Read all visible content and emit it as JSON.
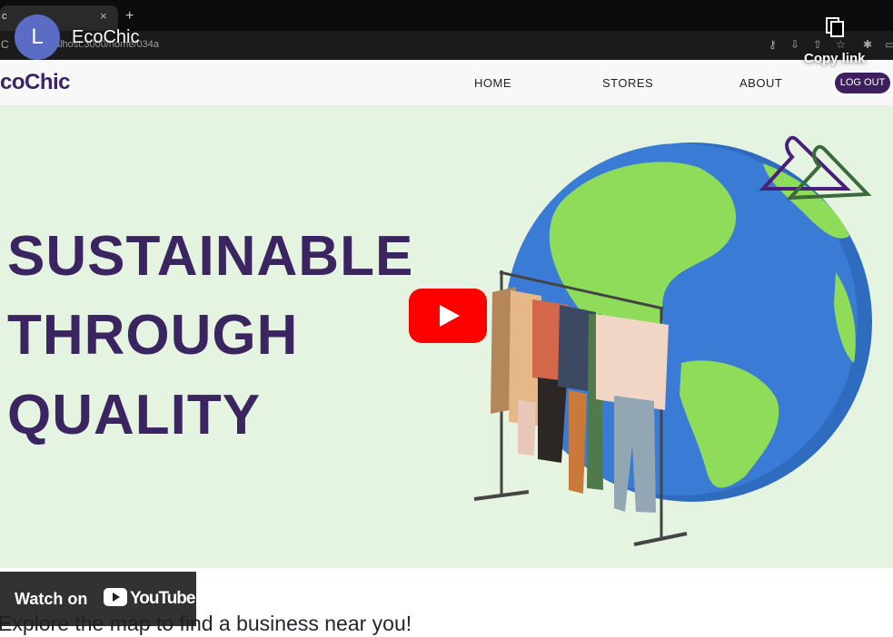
{
  "browser": {
    "tab_title": "c",
    "tab_close": "×",
    "new_tab": "+",
    "url": "alhost:3000/home/034a",
    "reload_icon": "reload-icon"
  },
  "youtube": {
    "avatar_letter": "L",
    "video_title": "EcoChic",
    "copy_link": "Copy link",
    "watch_on": "Watch on",
    "youtube_word": "YouTube"
  },
  "site": {
    "logo": "coChic",
    "nav": {
      "home": "HOME",
      "stores": "STORES",
      "about": "ABOUT",
      "logout": "LOG OUT"
    },
    "headline": [
      "SUSTAINABLE",
      "THROUGH",
      "QUALITY"
    ],
    "explore": "Explore the map to find a business near you!"
  },
  "colors": {
    "brand_purple": "#3b2560",
    "hero_bg": "#e5f3e1",
    "youtube_red": "#ff0000",
    "globe_ocean": "#3a7bd5",
    "globe_land": "#8fdb5a"
  }
}
